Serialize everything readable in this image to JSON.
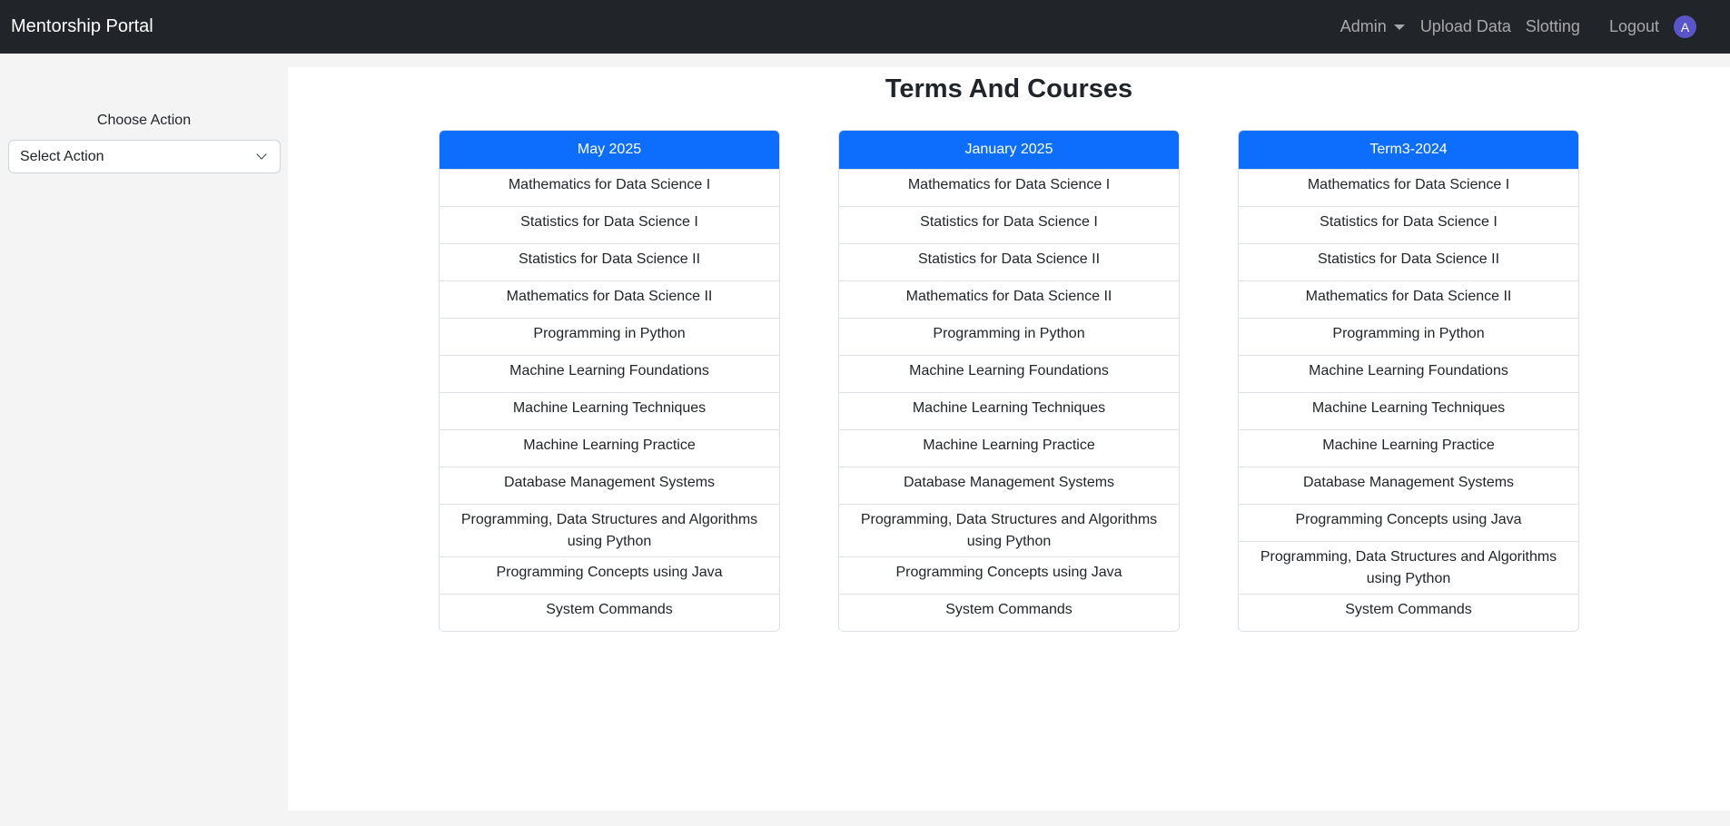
{
  "navbar": {
    "brand": "Mentorship Portal",
    "admin_label": "Admin",
    "upload_label": "Upload Data",
    "slotting_label": "Slotting",
    "logout_label": "Logout",
    "avatar_initial": "A"
  },
  "sidebar": {
    "label": "Choose Action",
    "select_value": "Select Action"
  },
  "main": {
    "title": "Terms And Courses",
    "terms": [
      {
        "name": "May 2025",
        "courses": [
          "Mathematics for Data Science I",
          "Statistics for Data Science I",
          "Statistics for Data Science II",
          "Mathematics for Data Science II",
          "Programming in Python",
          "Machine Learning Foundations",
          "Machine Learning Techniques",
          "Machine Learning Practice",
          "Database Management Systems",
          "Programming, Data Structures and Algorithms using Python",
          "Programming Concepts using Java",
          "System Commands"
        ]
      },
      {
        "name": "January 2025",
        "courses": [
          "Mathematics for Data Science I",
          "Statistics for Data Science I",
          "Statistics for Data Science II",
          "Mathematics for Data Science II",
          "Programming in Python",
          "Machine Learning Foundations",
          "Machine Learning Techniques",
          "Machine Learning Practice",
          "Database Management Systems",
          "Programming, Data Structures and Algorithms using Python",
          "Programming Concepts using Java",
          "System Commands"
        ]
      },
      {
        "name": "Term3-2024",
        "courses": [
          "Mathematics for Data Science I",
          "Statistics for Data Science I",
          "Statistics for Data Science II",
          "Mathematics for Data Science II",
          "Programming in Python",
          "Machine Learning Foundations",
          "Machine Learning Techniques",
          "Machine Learning Practice",
          "Database Management Systems",
          "Programming Concepts using Java",
          "Programming, Data Structures and Algorithms using Python",
          "System Commands"
        ]
      }
    ]
  },
  "colors": {
    "navbar_bg": "#212529",
    "term_header_bg": "#0d6efd",
    "avatar_bg": "#5a55c9"
  },
  "icons": {
    "admin_dropdown": "caret-down-icon",
    "select_dropdown": "chevron-down-icon"
  }
}
